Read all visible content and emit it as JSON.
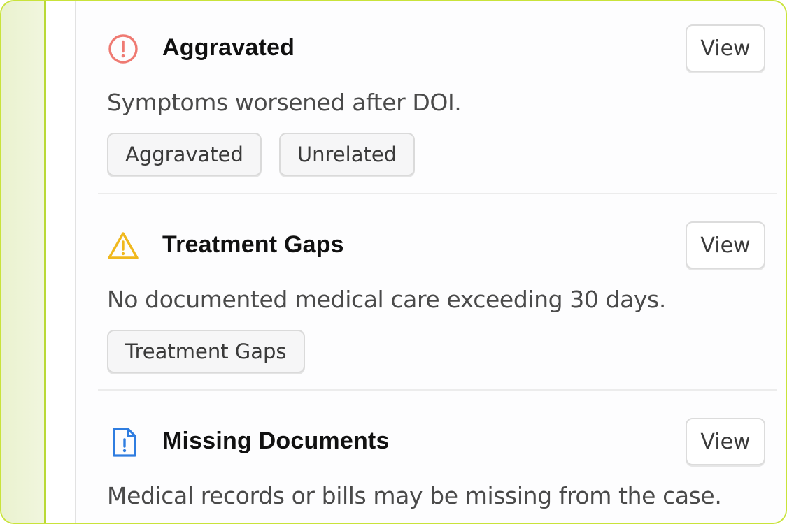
{
  "issues": [
    {
      "icon": "alert-circle-icon",
      "icon_color": "#ef7a72",
      "title": "Aggravated",
      "description": "Symptoms worsened after DOI.",
      "view_label": "View",
      "tags": [
        "Aggravated",
        "Unrelated"
      ]
    },
    {
      "icon": "warning-triangle-icon",
      "icon_color": "#f0b81e",
      "title": "Treatment Gaps",
      "description": "No documented medical care exceeding 30 days.",
      "view_label": "View",
      "tags": [
        "Treatment Gaps"
      ]
    },
    {
      "icon": "document-alert-icon",
      "icon_color": "#2f7de0",
      "title": "Missing Documents",
      "description": "Medical records or bills may be missing from the case.",
      "view_label": "View",
      "tags": []
    }
  ]
}
